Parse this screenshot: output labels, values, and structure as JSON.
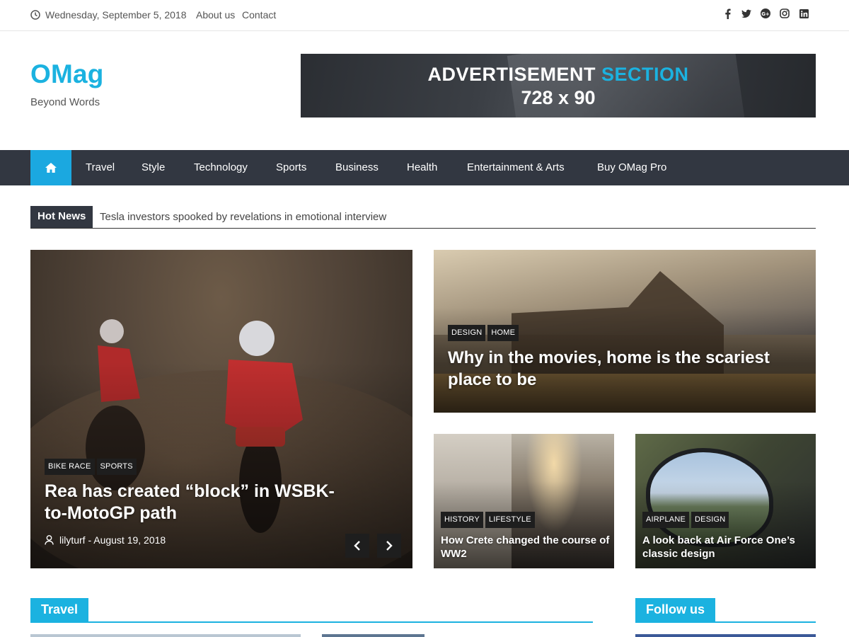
{
  "topbar": {
    "date": "Wednesday, September 5, 2018",
    "links": [
      "About us",
      "Contact"
    ],
    "social_icons": [
      "facebook-icon",
      "twitter-icon",
      "google-plus-icon",
      "instagram-icon",
      "linkedin-icon"
    ]
  },
  "header": {
    "site_title": "OMag",
    "tagline": "Beyond Words",
    "ad": {
      "line1_main": "ADVERTISEMENT",
      "line1_accent": "SECTION",
      "line2": "728 x 90"
    }
  },
  "nav": {
    "items": [
      "Travel",
      "Style",
      "Technology",
      "Sports",
      "Business",
      "Health",
      "Entertainment & Arts",
      "Buy OMag Pro"
    ]
  },
  "hot_news": {
    "label": "Hot News",
    "headline": "Tesla investors spooked by revelations in emotional interview"
  },
  "featured": {
    "main": {
      "tags": [
        "BIKE RACE",
        "SPORTS"
      ],
      "title": "Rea has created “block” in WSBK-to-MotoGP path",
      "meta": "lilyturf - August 19, 2018"
    },
    "top_right": {
      "tags": [
        "DESIGN",
        "HOME"
      ],
      "title": "Why in the movies, home is the scariest place to be"
    },
    "bottom_left": {
      "tags": [
        "HISTORY",
        "LIFESTYLE"
      ],
      "title": "How Crete changed the course of WW2"
    },
    "bottom_right": {
      "tags": [
        "AIRPLANE",
        "DESIGN"
      ],
      "title": "A look back at Air Force One’s classic design"
    }
  },
  "sections": {
    "travel": "Travel",
    "follow": "Follow us"
  },
  "colors": {
    "accent": "#1bb2e0",
    "nav_bg": "#323741",
    "tag_bg": "#1e1e1e"
  }
}
